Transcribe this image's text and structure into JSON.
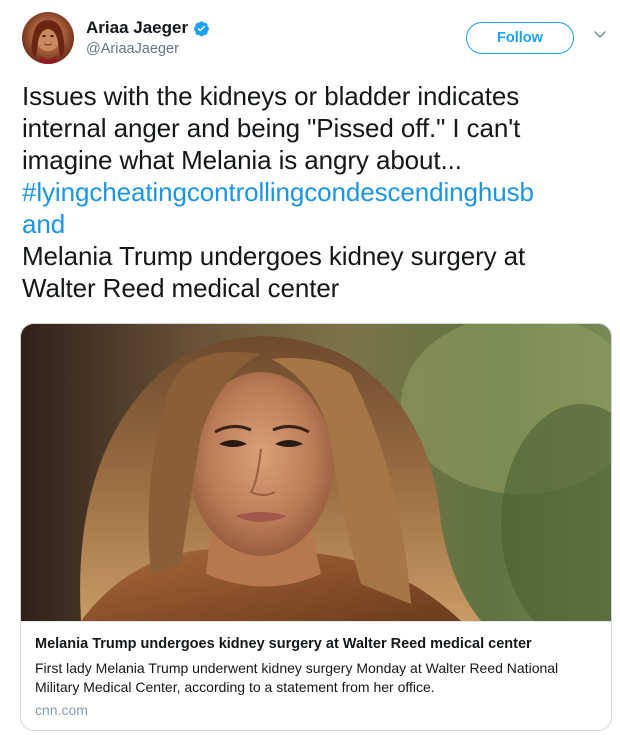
{
  "user": {
    "display_name": "Ariaa Jaeger",
    "handle": "@AriaaJaeger",
    "verified_icon": "verified-badge-icon"
  },
  "actions": {
    "follow_label": "Follow",
    "more_icon": "chevron-down-icon"
  },
  "tweet": {
    "lines": [
      "Issues with the kidneys or bladder indicates",
      "internal anger and being \"Pissed off.\" I can't",
      "imagine what Melania is angry about..."
    ],
    "hashtag_line1": "#lyingcheatingcontrollingcondescendinghusb",
    "hashtag_line2": "and",
    "after_lines": [
      "Melania Trump undergoes kidney surgery at",
      "Walter Reed medical center"
    ]
  },
  "card": {
    "title": "Melania Trump undergoes kidney surgery at Walter Reed medical center",
    "description": "First lady Melania Trump underwent kidney surgery Monday at Walter Reed National Military Medical Center, according to a statement from her office.",
    "domain": "cnn.com"
  },
  "colors": {
    "link": "#1b95e0",
    "follow": "#1da1f2",
    "muted": "#657786",
    "border": "#ccd6dd"
  }
}
